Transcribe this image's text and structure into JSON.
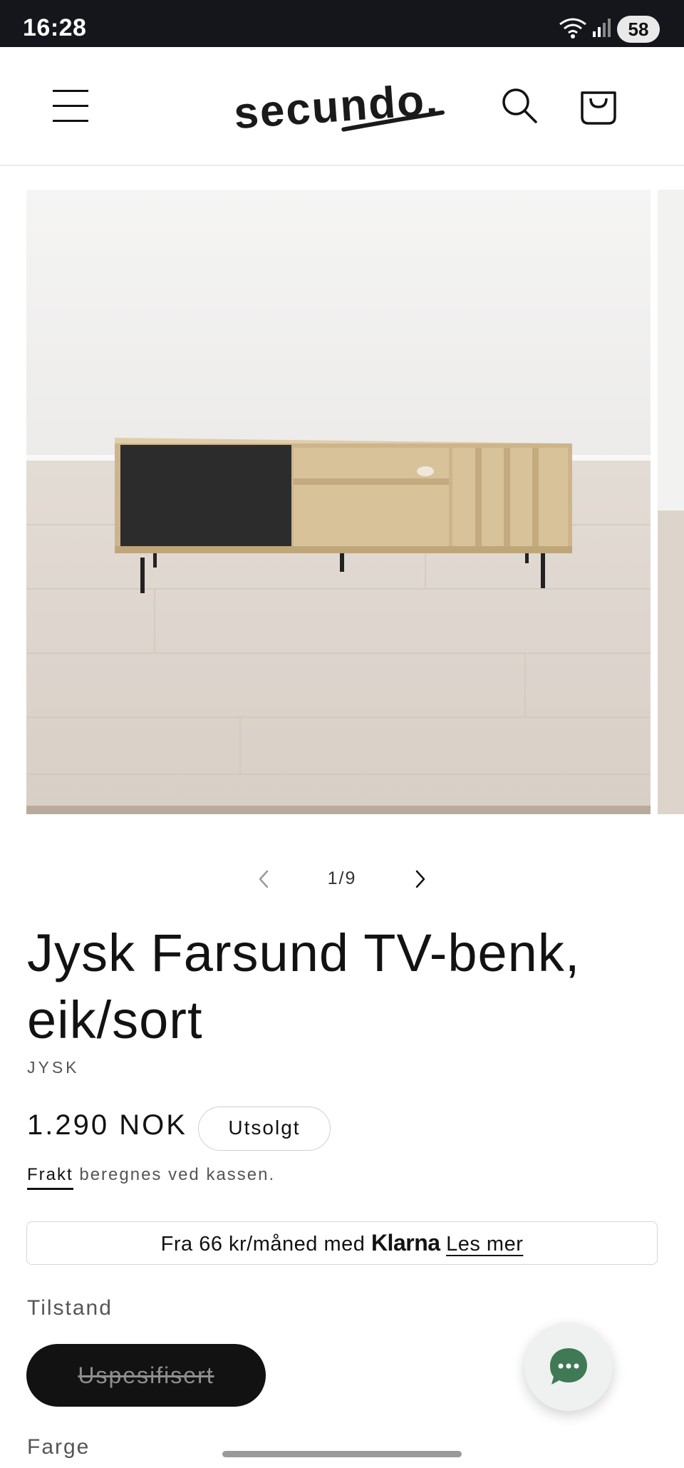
{
  "status_bar": {
    "time": "16:28",
    "battery": "58"
  },
  "header": {
    "logo_text": "secundo.",
    "icons": [
      "menu-icon",
      "search-icon",
      "cart-icon"
    ]
  },
  "gallery": {
    "counter": "1/9",
    "current_index": 1,
    "total": 9
  },
  "product": {
    "title": "Jysk Farsund TV-benk, eik/sort",
    "vendor": "JYSK",
    "price": "1.290 NOK",
    "status_badge": "Utsolgt",
    "shipping_link": "Frakt",
    "shipping_rest": " beregnes ved kassen."
  },
  "klarna": {
    "prefix": "Fra 66 kr/måned med ",
    "brand": "Klarna",
    "link": "Les mer"
  },
  "options": {
    "condition_label": "Tilstand",
    "condition_value": "Uspesifisert",
    "color_label": "Farge"
  },
  "colors": {
    "text": "#121212",
    "status_bar": "#14161c",
    "chat_accent": "#3f7a55"
  }
}
